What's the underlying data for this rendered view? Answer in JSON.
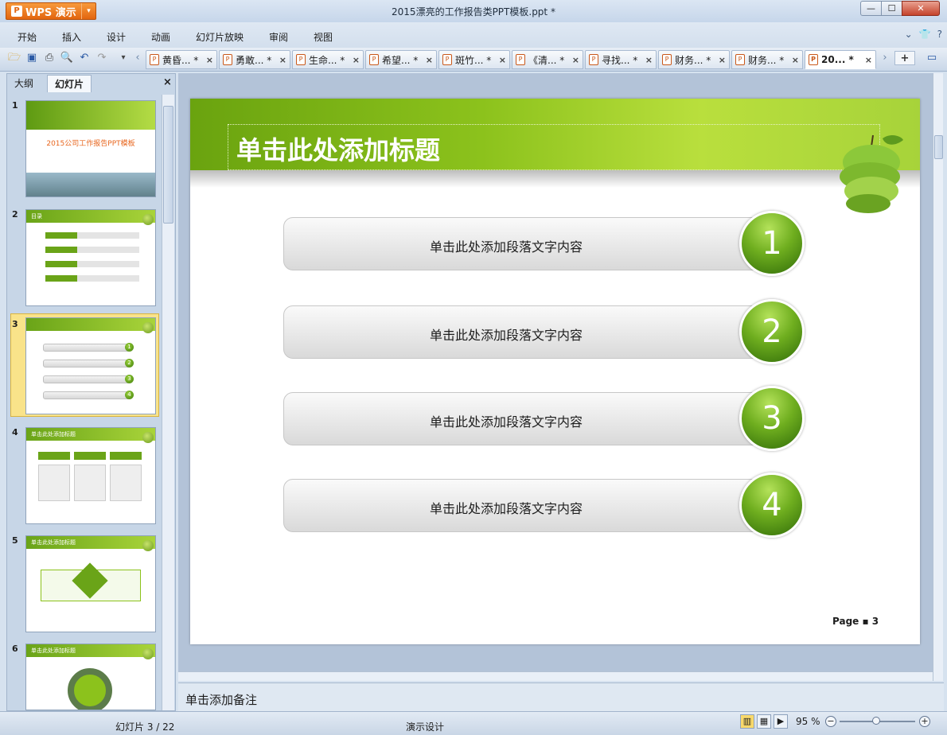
{
  "app": {
    "name": "WPS 演示",
    "doc_title": "2015漂亮的工作报告类PPT模板.ppt *"
  },
  "window": {
    "minimize": "—",
    "maximize": "☐",
    "close": "✕"
  },
  "menu": [
    "开始",
    "插入",
    "设计",
    "动画",
    "幻灯片放映",
    "审阅",
    "视图"
  ],
  "menu_right": {
    "collapse": "⌄",
    "skin": "👕",
    "help": "?"
  },
  "quick_toolbar": [
    "open-icon",
    "save-icon",
    "print-icon",
    "print-preview-icon",
    "undo-icon",
    "redo-icon",
    "more-icon",
    "scroll-left-icon"
  ],
  "tabs": [
    {
      "label": "黄昏... *"
    },
    {
      "label": "勇敢... *"
    },
    {
      "label": "生命... *"
    },
    {
      "label": "希望... *"
    },
    {
      "label": "斑竹... *"
    },
    {
      "label": "《清... *"
    },
    {
      "label": "寻找... *"
    },
    {
      "label": "财务... *"
    },
    {
      "label": "财务... *"
    },
    {
      "label": "20... *"
    }
  ],
  "tab_close": "×",
  "new_tab": "+",
  "panel": {
    "tab_outline": "大纲",
    "tab_slides": "幻灯片",
    "close": "×"
  },
  "thumbnails": [
    {
      "num": "1",
      "title": "2015公司工作报告PPT模板"
    },
    {
      "num": "2",
      "title": "目录"
    },
    {
      "num": "3",
      "title": ""
    },
    {
      "num": "4",
      "title": "单击此处添加标题"
    },
    {
      "num": "5",
      "title": "单击此处添加标题"
    },
    {
      "num": "6",
      "title": "单击此处添加标题"
    }
  ],
  "slide": {
    "title": "单击此处添加标题",
    "items": [
      {
        "num": "1",
        "text": "单击此处添加段落文字内容"
      },
      {
        "num": "2",
        "text": "单击此处添加段落文字内容"
      },
      {
        "num": "3",
        "text": "单击此处添加段落文字内容"
      },
      {
        "num": "4",
        "text": "单击此处添加段落文字内容"
      }
    ],
    "page": "Page ▪ 3"
  },
  "notes": "单击添加备注",
  "status": {
    "slides": "幻灯片 3 / 22",
    "design": "演示设计",
    "zoom": "95 %"
  },
  "colors": {
    "accent_green": "#7fb81e",
    "wps_orange": "#e2650f"
  }
}
